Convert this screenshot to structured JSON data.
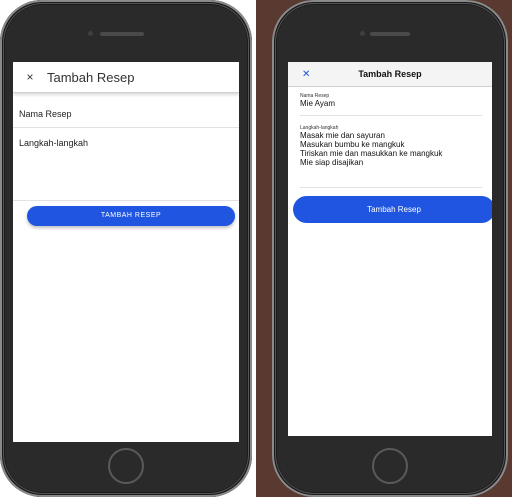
{
  "left_screen": {
    "header": {
      "close_icon": "×",
      "title": "Tambah Resep"
    },
    "name_field": {
      "placeholder": "Nama Resep"
    },
    "steps_field": {
      "placeholder": "Langkah-langkah"
    },
    "submit_label": "TAMBAH RESEP"
  },
  "right_screen": {
    "header": {
      "close_icon": "✕",
      "title": "Tambah Resep"
    },
    "name_field": {
      "label": "Nama Resep",
      "value": "Mie Ayam"
    },
    "steps_field": {
      "label": "Langkah-langkah",
      "lines": [
        "Masak mie dan sayuran",
        "Masukan bumbu ke mangkuk",
        "Tiriskan mie dan masukkan ke mangkuk",
        "Mie siap disajikan"
      ]
    },
    "submit_label": "Tambah Resep"
  },
  "colors": {
    "accent": "#1f55e0",
    "frame": "#2a2a2a",
    "background": "#5a3a30"
  },
  "icons": {
    "close": "close-icon"
  }
}
